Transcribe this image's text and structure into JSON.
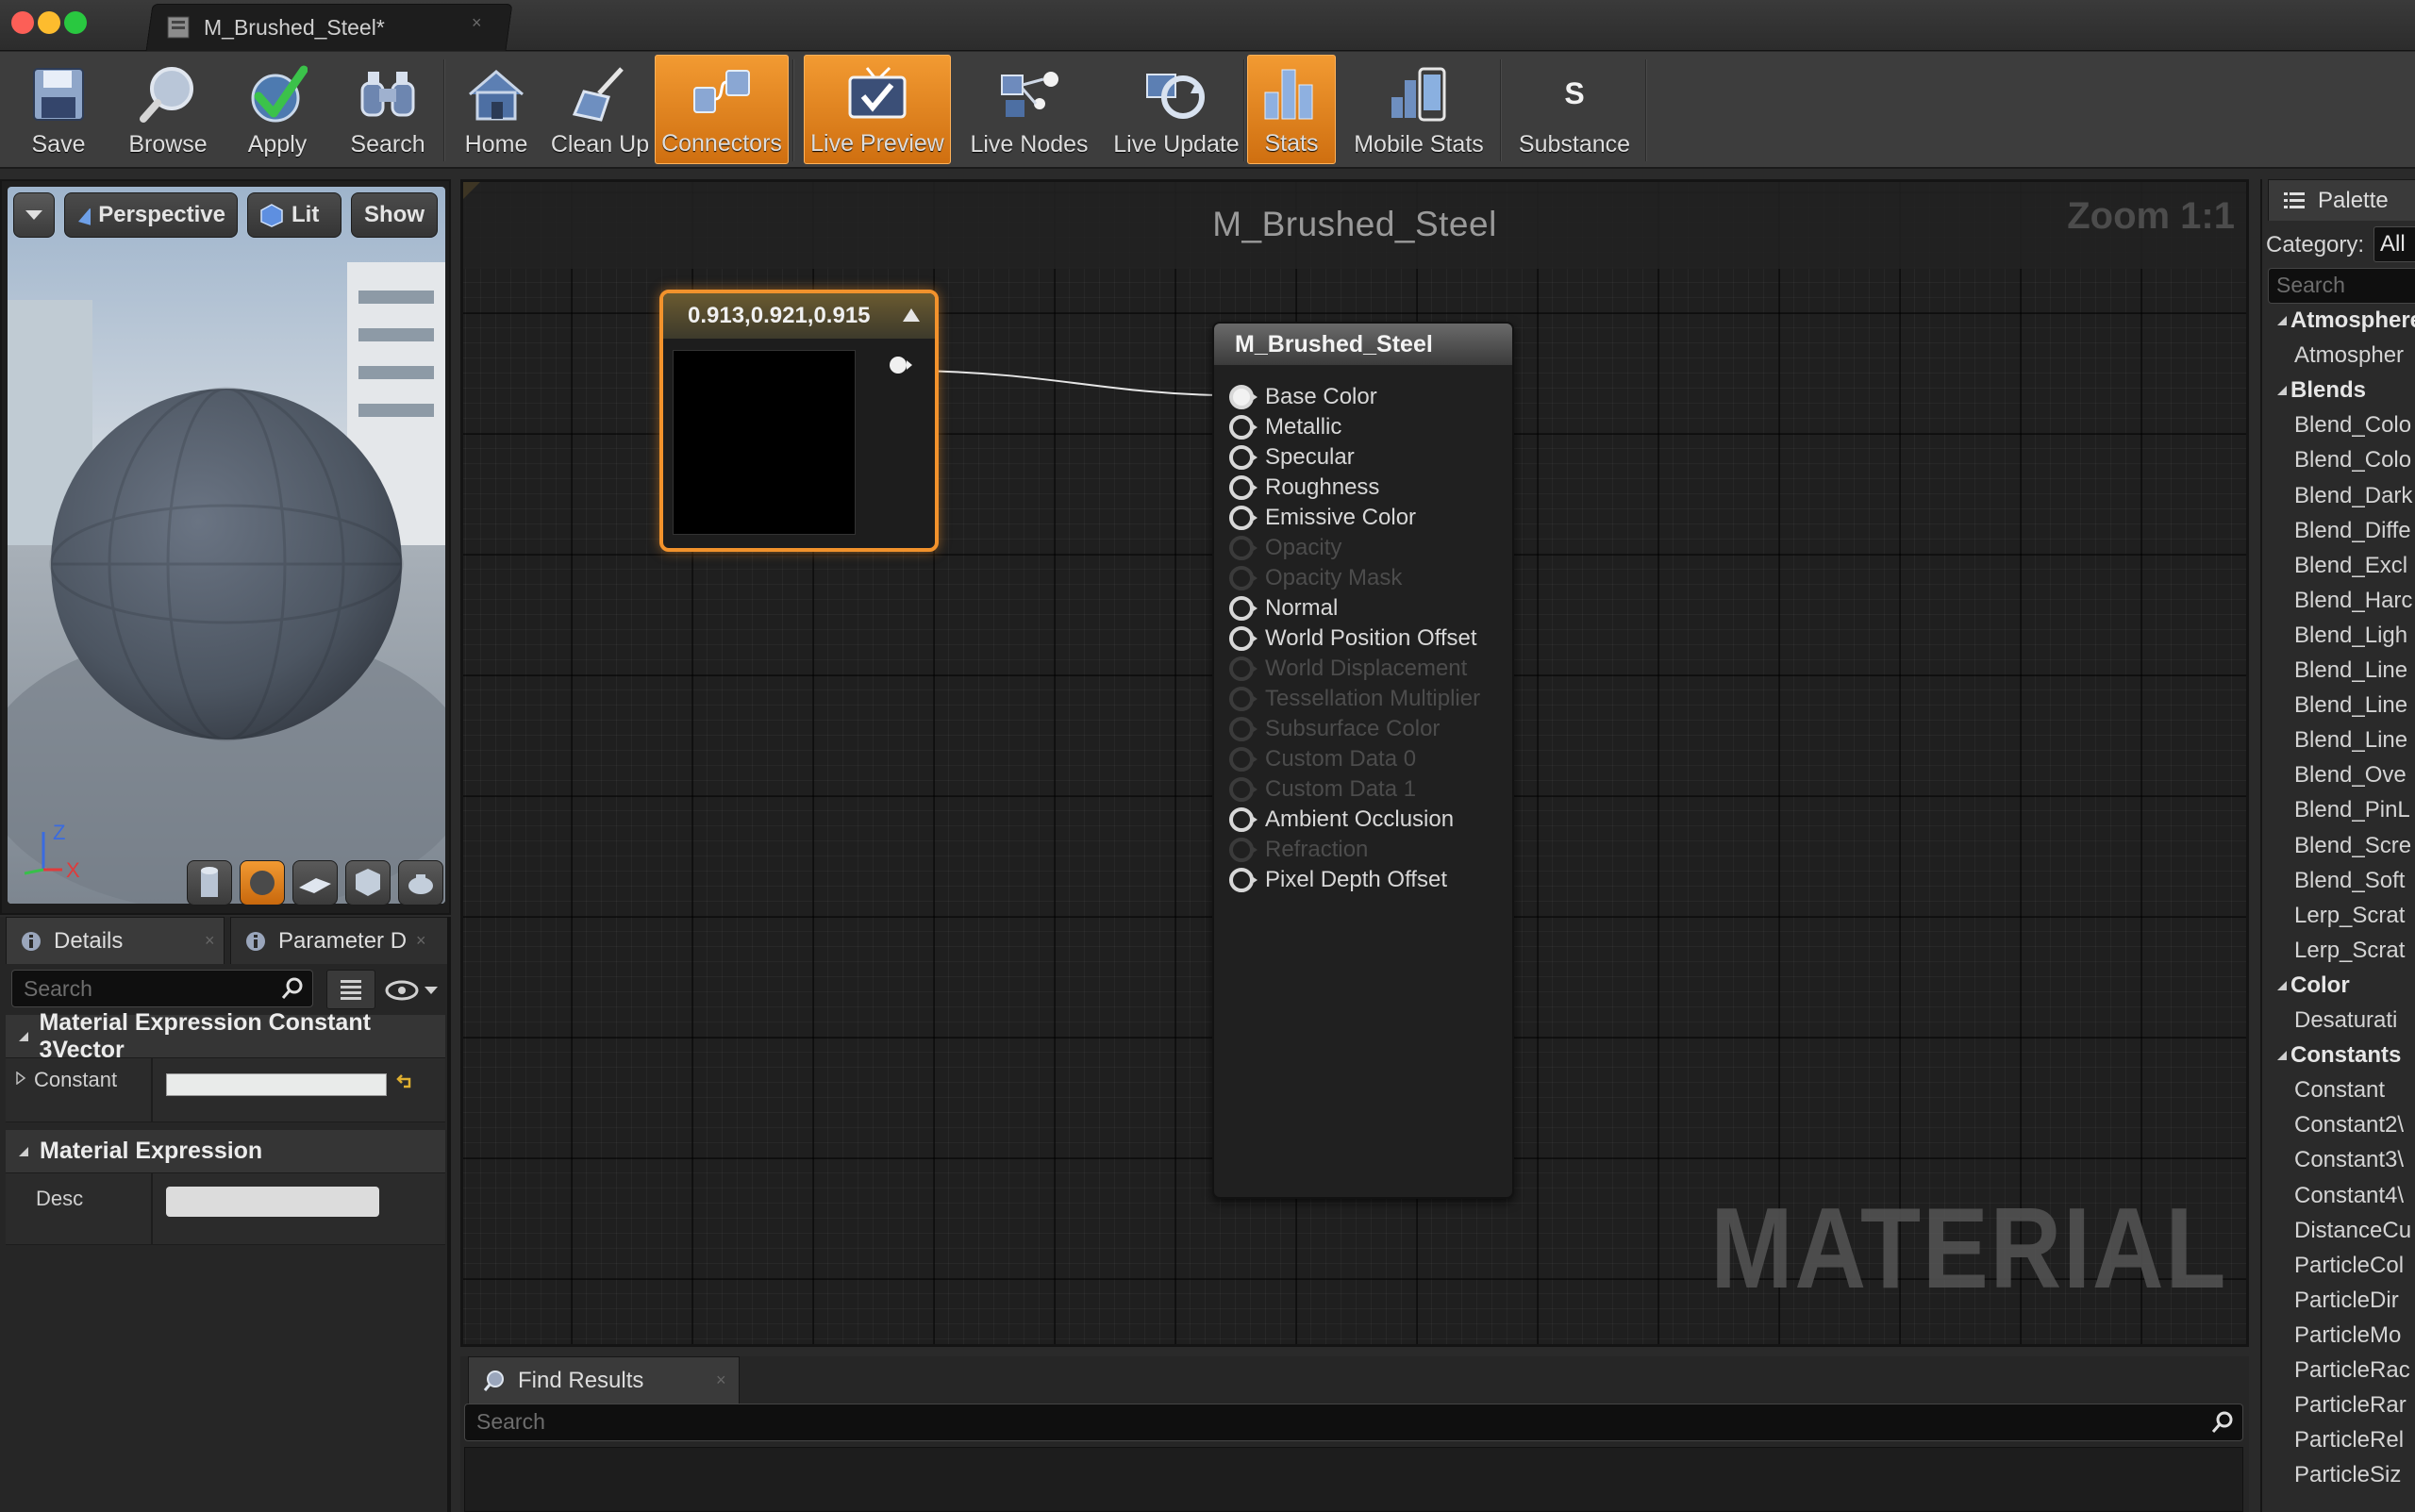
{
  "window": {
    "tab_title": "M_Brushed_Steel*"
  },
  "toolbar": {
    "buttons": [
      {
        "label": "Save"
      },
      {
        "label": "Browse"
      },
      {
        "label": "Apply"
      },
      {
        "label": "Search"
      },
      {
        "label": "Home"
      },
      {
        "label": "Clean Up"
      },
      {
        "label": "Connectors"
      },
      {
        "label": "Live Preview"
      },
      {
        "label": "Live Nodes"
      },
      {
        "label": "Live Update"
      },
      {
        "label": "Stats"
      },
      {
        "label": "Mobile Stats"
      },
      {
        "label": "Substance"
      }
    ]
  },
  "viewport": {
    "perspective_label": "Perspective",
    "lit_label": "Lit",
    "show_label": "Show",
    "axis_z": "Z",
    "axis_x": "X"
  },
  "details": {
    "tab_details": "Details",
    "tab_parameter": "Parameter D",
    "search_placeholder": "Search",
    "category_1": "Material Expression Constant 3Vector",
    "constant_label": "Constant",
    "category_2": "Material Expression",
    "desc_label": "Desc"
  },
  "graph": {
    "title": "M_Brushed_Steel",
    "zoom": "Zoom 1:1",
    "watermark": "MATERIAL",
    "constant_node_value": "0.913,0.921,0.915",
    "material_node_title": "M_Brushed_Steel",
    "pins": [
      {
        "label": "Base Color",
        "enabled": true,
        "connected": true
      },
      {
        "label": "Metallic",
        "enabled": true
      },
      {
        "label": "Specular",
        "enabled": true
      },
      {
        "label": "Roughness",
        "enabled": true
      },
      {
        "label": "Emissive Color",
        "enabled": true
      },
      {
        "label": "Opacity",
        "enabled": false
      },
      {
        "label": "Opacity Mask",
        "enabled": false
      },
      {
        "label": "Normal",
        "enabled": true
      },
      {
        "label": "World Position Offset",
        "enabled": true
      },
      {
        "label": "World Displacement",
        "enabled": false
      },
      {
        "label": "Tessellation Multiplier",
        "enabled": false
      },
      {
        "label": "Subsurface Color",
        "enabled": false
      },
      {
        "label": "Custom Data 0",
        "enabled": false
      },
      {
        "label": "Custom Data 1",
        "enabled": false
      },
      {
        "label": "Ambient Occlusion",
        "enabled": true
      },
      {
        "label": "Refraction",
        "enabled": false
      },
      {
        "label": "Pixel Depth Offset",
        "enabled": true
      }
    ]
  },
  "find_results": {
    "tab_label": "Find Results",
    "search_placeholder": "Search"
  },
  "palette": {
    "title": "Palette",
    "category_label": "Category:",
    "category_value": "All",
    "search_placeholder": "Search",
    "entries": [
      {
        "text": "Atmosphere",
        "is_category": true
      },
      {
        "text": "Atmospher",
        "is_category": false
      },
      {
        "text": "Blends",
        "is_category": true
      },
      {
        "text": "Blend_Colo",
        "is_category": false
      },
      {
        "text": "Blend_Colo",
        "is_category": false
      },
      {
        "text": "Blend_Dark",
        "is_category": false
      },
      {
        "text": "Blend_Diffe",
        "is_category": false
      },
      {
        "text": "Blend_Excl",
        "is_category": false
      },
      {
        "text": "Blend_Harc",
        "is_category": false
      },
      {
        "text": "Blend_Ligh",
        "is_category": false
      },
      {
        "text": "Blend_Line",
        "is_category": false
      },
      {
        "text": "Blend_Line",
        "is_category": false
      },
      {
        "text": "Blend_Line",
        "is_category": false
      },
      {
        "text": "Blend_Ove",
        "is_category": false
      },
      {
        "text": "Blend_PinL",
        "is_category": false
      },
      {
        "text": "Blend_Scre",
        "is_category": false
      },
      {
        "text": "Blend_Soft",
        "is_category": false
      },
      {
        "text": "Lerp_Scrat",
        "is_category": false
      },
      {
        "text": "Lerp_Scrat",
        "is_category": false
      },
      {
        "text": "Color",
        "is_category": true
      },
      {
        "text": "Desaturati",
        "is_category": false
      },
      {
        "text": "Constants",
        "is_category": true
      },
      {
        "text": "Constant",
        "is_category": false
      },
      {
        "text": "Constant2\\",
        "is_category": false
      },
      {
        "text": "Constant3\\",
        "is_category": false
      },
      {
        "text": "Constant4\\",
        "is_category": false
      },
      {
        "text": "DistanceCu",
        "is_category": false
      },
      {
        "text": "ParticleCol",
        "is_category": false
      },
      {
        "text": "ParticleDir",
        "is_category": false
      },
      {
        "text": "ParticleMo",
        "is_category": false
      },
      {
        "text": "ParticleRac",
        "is_category": false
      },
      {
        "text": "ParticleRar",
        "is_category": false
      },
      {
        "text": "ParticleRel",
        "is_category": false
      },
      {
        "text": "ParticleSiz",
        "is_category": false
      }
    ]
  },
  "colors": {
    "accent": "#f2922c",
    "panel": "#262626",
    "graph_bg": "#1f1f1f"
  }
}
